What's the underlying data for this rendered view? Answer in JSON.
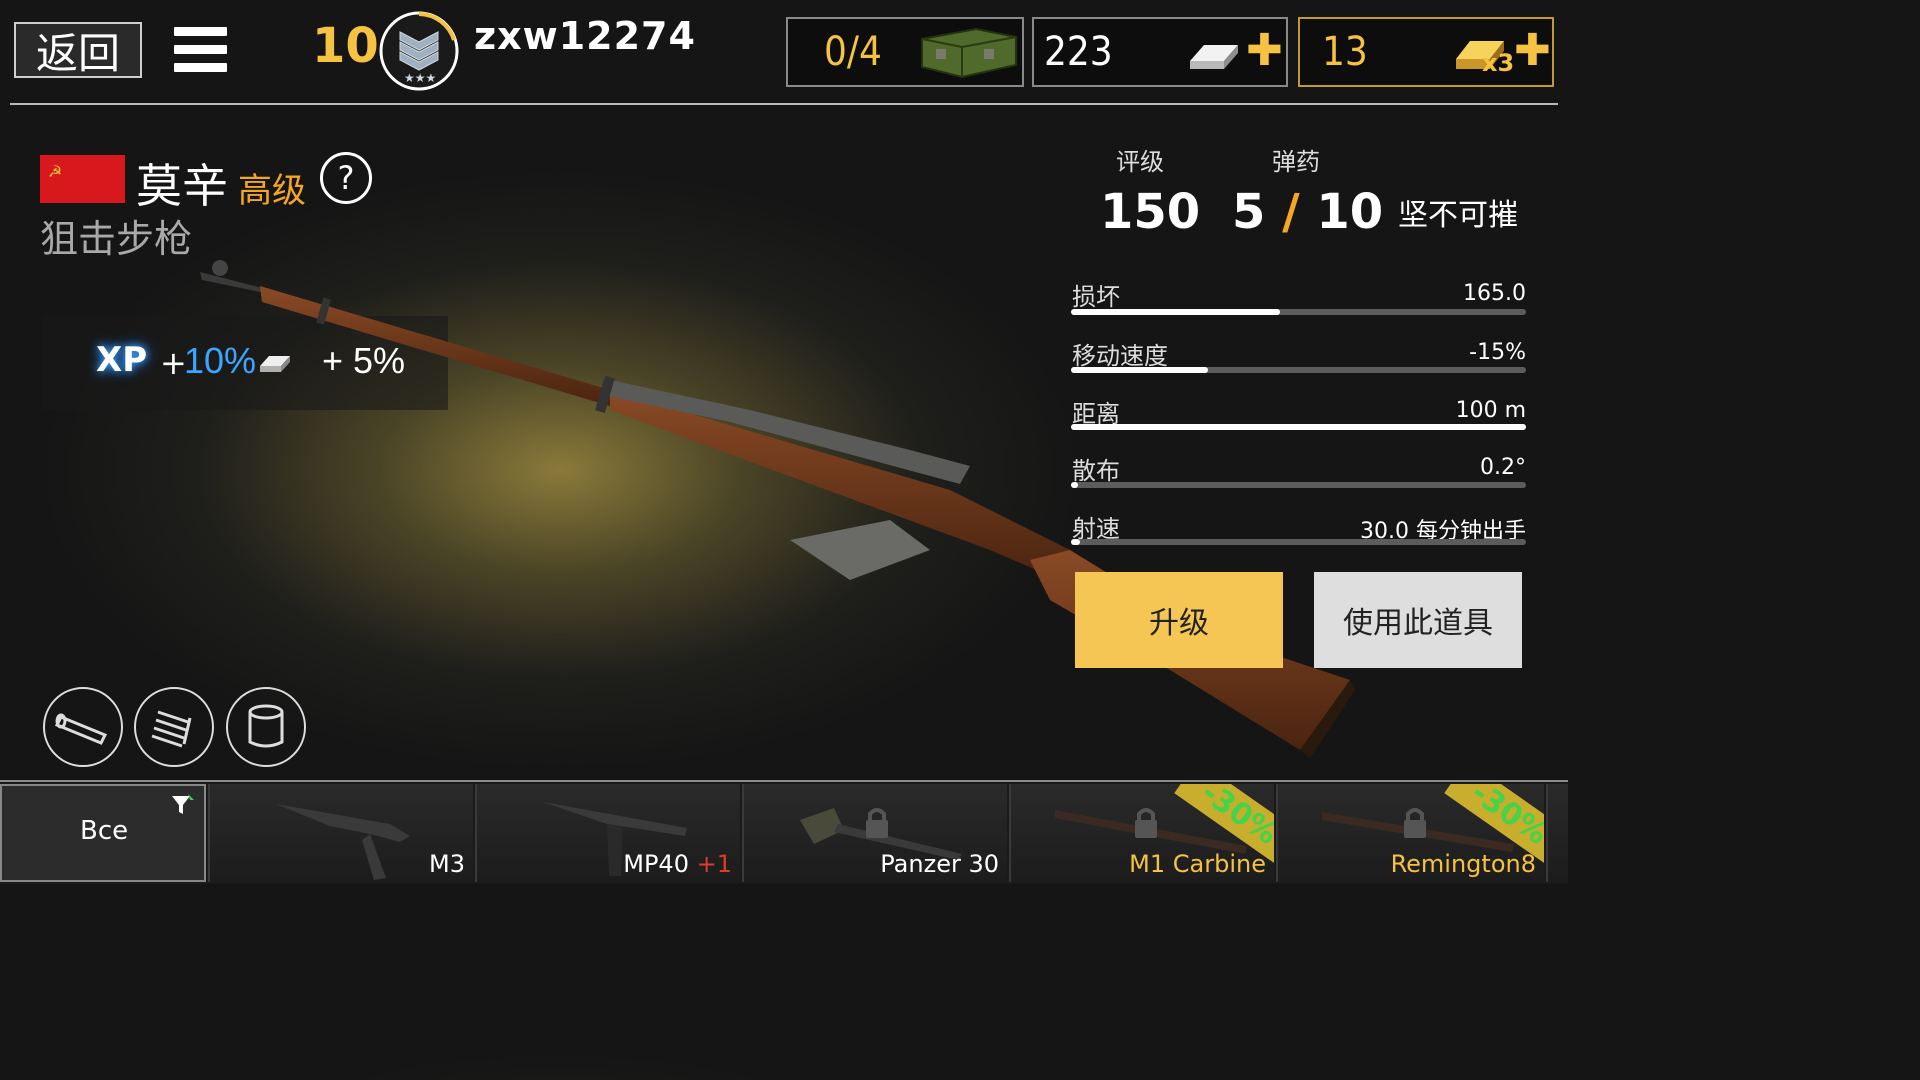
{
  "topbar": {
    "back_label": "返回",
    "level": "10",
    "username": "zxw12274",
    "crates": "0/4",
    "silver": "223",
    "gold": "13",
    "gold_multiplier": "x3"
  },
  "weapon": {
    "name": "莫辛",
    "tier": "高级",
    "help": "?",
    "class": "狙击步枪",
    "xp_label": "XP",
    "xp_plus": "+",
    "xp_bonus": "10%",
    "silver_bonus": "+ 5%"
  },
  "stats": {
    "rating_label": "评级",
    "ammo_label": "弹药",
    "rating": "150",
    "ammo_current": "5",
    "ammo_sep": "/",
    "ammo_max": "10",
    "trait": "坚不可摧",
    "rows": [
      {
        "label": "损坏",
        "value": "165.0",
        "level": 0.46
      },
      {
        "label": "移动速度",
        "value": "-15%",
        "level": 0.3
      },
      {
        "label": "距离",
        "value": "100 m",
        "level": 1.0
      },
      {
        "label": "散布",
        "value": "0.2°",
        "level": 0.01
      },
      {
        "label": "射速",
        "value": "30.0 每分钟出手",
        "level": 0.02
      }
    ]
  },
  "actions": {
    "upgrade": "升级",
    "use": "使用此道具"
  },
  "tray": {
    "filter_label": "Все",
    "items": [
      {
        "name": "M3",
        "extra": ""
      },
      {
        "name": "MP40",
        "extra": "+1"
      },
      {
        "name": "Panzer 30",
        "extra": ""
      },
      {
        "name": "M1 Carbine",
        "extra": "",
        "discount": "-30%"
      },
      {
        "name": "Remington8",
        "extra": "",
        "discount": "-30%"
      }
    ]
  },
  "colors": {
    "accent": "#f5c242",
    "xp_blue": "#3aa6ff",
    "upgrade_bg": "#f5c654",
    "discount_green": "#44d44a"
  }
}
